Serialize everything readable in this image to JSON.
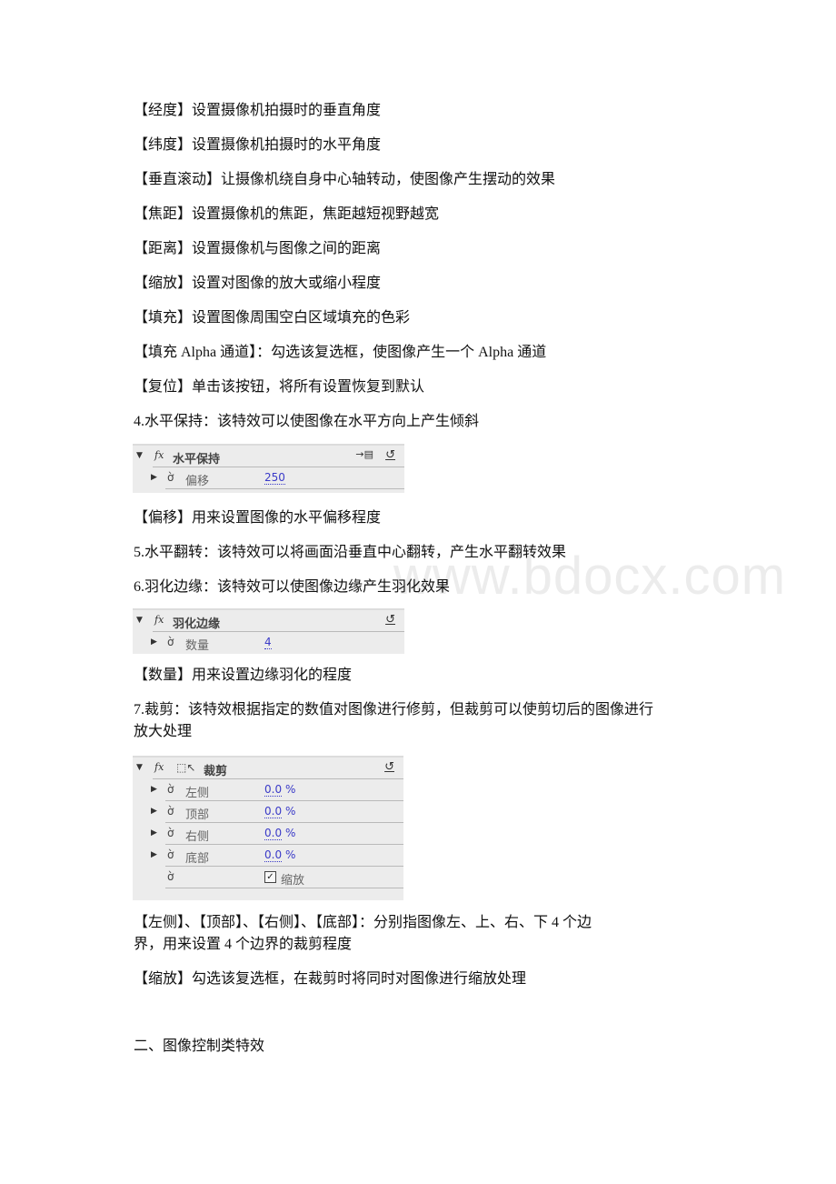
{
  "paragraphs": {
    "p1": "【经度】设置摄像机拍摄时的垂直角度",
    "p2": "【纬度】设置摄像机拍摄时的水平角度",
    "p3": "【垂直滚动】让摄像机绕自身中心轴转动，使图像产生摆动的效果",
    "p4": "【焦距】设置摄像机的焦距，焦距越短视野越宽",
    "p5": "【距离】设置摄像机与图像之间的距离",
    "p6": "【缩放】设置对图像的放大或缩小程度",
    "p7": "【填充】设置图像周围空白区域填充的色彩",
    "p8": "【填充 Alpha 通道】：勾选该复选框，使图像产生一个 Alpha 通道",
    "p9": "【复位】单击该按钮，将所有设置恢复到默认",
    "p10": "4.水平保持：该特效可以使图像在水平方向上产生倾斜",
    "p11": "【偏移】用来设置图像的水平偏移程度",
    "p12": "5.水平翻转：该特效可以将画面沿垂直中心翻转，产生水平翻转效果",
    "p13": "6.羽化边缘：该特效可以使图像边缘产生羽化效果",
    "p14": "【数量】用来设置边缘羽化的程度",
    "p15a": "7.裁剪：该特效根据指定的数值对图像进行修剪，但裁剪可以使剪切后的图像进行",
    "p15b": "放大处理",
    "p16a": "【左侧】、【顶部】、【右侧】、【底部】：分别指图像左、上、右、下 4 个边",
    "p16b": "界，用来设置 4 个边界的裁剪程度",
    "p17": "【缩放】勾选该复选框，在裁剪时将同时对图像进行缩放处理",
    "section": "二、图像控制类特效"
  },
  "watermark": "www.bdocx.com",
  "panels": {
    "horizontal_hold": {
      "title": "水平保持",
      "fx": "fx",
      "keyframe_icon": "→▤",
      "reset_icon": "↺",
      "params": [
        {
          "label": "偏移",
          "value": "250"
        }
      ]
    },
    "feather_edges": {
      "title": "羽化边缘",
      "fx": "fx",
      "reset_icon": "↺",
      "params": [
        {
          "label": "数量",
          "value": "4"
        }
      ]
    },
    "crop": {
      "title": "裁剪",
      "fx": "fx",
      "crop_icon": "⬚↖",
      "reset_icon": "↺",
      "params": [
        {
          "label": "左侧",
          "value": "0.0",
          "unit": "%"
        },
        {
          "label": "顶部",
          "value": "0.0",
          "unit": "%"
        },
        {
          "label": "右侧",
          "value": "0.0",
          "unit": "%"
        },
        {
          "label": "底部",
          "value": "0.0",
          "unit": "%"
        }
      ],
      "zoom_checkbox": {
        "label": "缩放",
        "checked": true,
        "mark": "✓"
      }
    }
  },
  "glyphs": {
    "expanded": "▼",
    "collapsed": "▶",
    "stopwatch": "ờ"
  }
}
